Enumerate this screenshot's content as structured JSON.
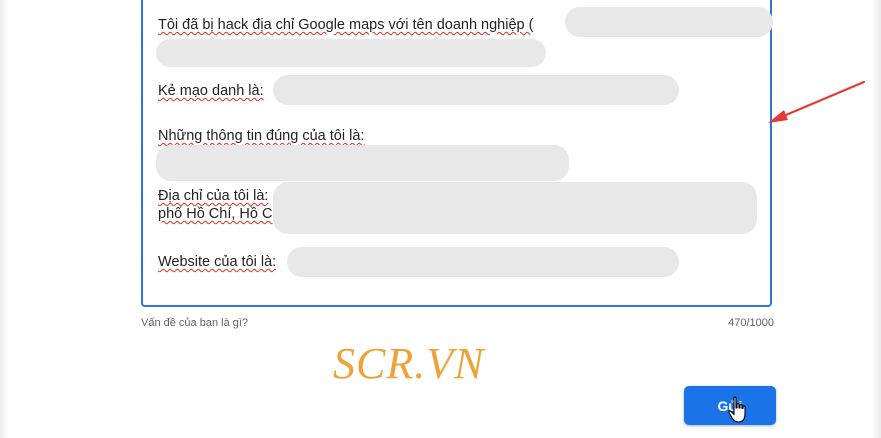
{
  "report": {
    "lines": {
      "line1": "Tôi đã bị hack địa chỉ Google maps với tên doanh nghiệp (",
      "line2": "Kẻ mạo danh là:",
      "line3": "Những thông tin đúng của tôi là:",
      "line4a": "Địa chỉ của tôi là:",
      "line4b": "phố Hồ Chí, Hồ C",
      "line5": "Website của tôi là:"
    },
    "caption": "Vấn đề của bạn là gì?",
    "counter": "470/1000"
  },
  "watermark": "SCR.VN",
  "send_button": {
    "label": "Gửi"
  },
  "colors": {
    "accent": "#1a73e8",
    "border": "#2a78d2",
    "arrow": "#e53935",
    "watermark": "#f0a23a"
  },
  "icons": {
    "cursor": "hand-pointer-icon",
    "arrow": "red-arrow-icon"
  }
}
